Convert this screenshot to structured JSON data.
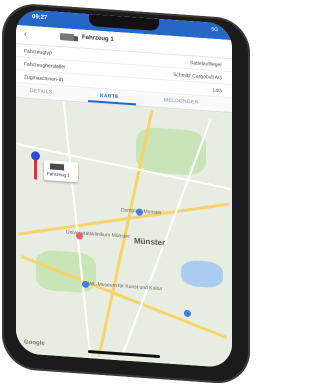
{
  "status": {
    "time": "09:27",
    "signal": "5G"
  },
  "appbar": {
    "title": "Fahrzeug 1"
  },
  "info_rows": [
    {
      "key": "Fahrzeugtyp",
      "value": "Sattelauflieger"
    },
    {
      "key": "Fahrzeughersteller",
      "value": "Schmitz Cargobull AG"
    },
    {
      "key": "Zugmaschinen-ID",
      "value": "14G"
    }
  ],
  "tabs": [
    {
      "label": "DETAILS"
    },
    {
      "label": "KARTE"
    },
    {
      "label": "MELDUNGEN"
    }
  ],
  "map": {
    "city": "Münster",
    "poi_1": "Domplatz Münster",
    "poi_2": "Universitätsklinikum Münster",
    "poi_3": "LWL-Museum für Kunst und Kultur",
    "marker_label": "Fahrzeug 1",
    "google_label": "Google"
  },
  "colors": {
    "primary": "#2567c7",
    "marker_red": "#d8343b",
    "marker_blue": "#2d4bd4"
  }
}
